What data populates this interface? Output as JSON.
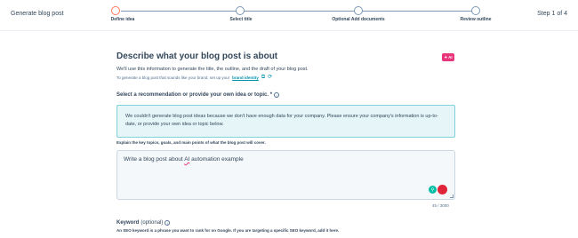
{
  "header": {
    "title": "Generate blog post",
    "step_counter": "Step 1 of 4",
    "steps": [
      {
        "label": "Define idea",
        "active": true
      },
      {
        "label": "Select title",
        "active": false
      },
      {
        "label": "Optional Add documents",
        "active": false
      },
      {
        "label": "Review outline",
        "active": false
      }
    ]
  },
  "section": {
    "title": "Describe what your blog post is about",
    "ai_badge": "✦ AI",
    "description": "We'll use this information to generate the title, the outline, and the draft of your blog post.",
    "brand_prefix": "To generate a blog post that sounds like your brand, set up your",
    "brand_link": "brand identity"
  },
  "recommendation": {
    "label": "Select a recommendation or provide your own idea or topic. *",
    "alert": "We couldn't generate blog post ideas because we don't have enough data for your company. Please ensure your company's information is up-to-date, or provide your own idea or topic below.",
    "explain": "Explain the key topics, goals, and main points of what the blog post will cover.",
    "idea_before": "Write a blog post about ",
    "idea_ai": "AI",
    "idea_after": " automation example",
    "char_count": "45 / 3000"
  },
  "keyword": {
    "label": "Keyword",
    "optional": "(optional)",
    "help": "An SEO keyword is a phrase you want to rank for on Google. If you are targeting a specific SEO keyword, add it here."
  },
  "colors": {
    "accent_orange": "#ff7a59",
    "ai_pink": "#e9357c",
    "alert_bg": "#e5f5f8",
    "link_teal": "#0091ae"
  },
  "icons": {
    "info": "info-icon",
    "external": "external-link-icon",
    "refresh": "refresh-icon",
    "grammar": "grammar-assist-icon",
    "record": "record-icon"
  }
}
